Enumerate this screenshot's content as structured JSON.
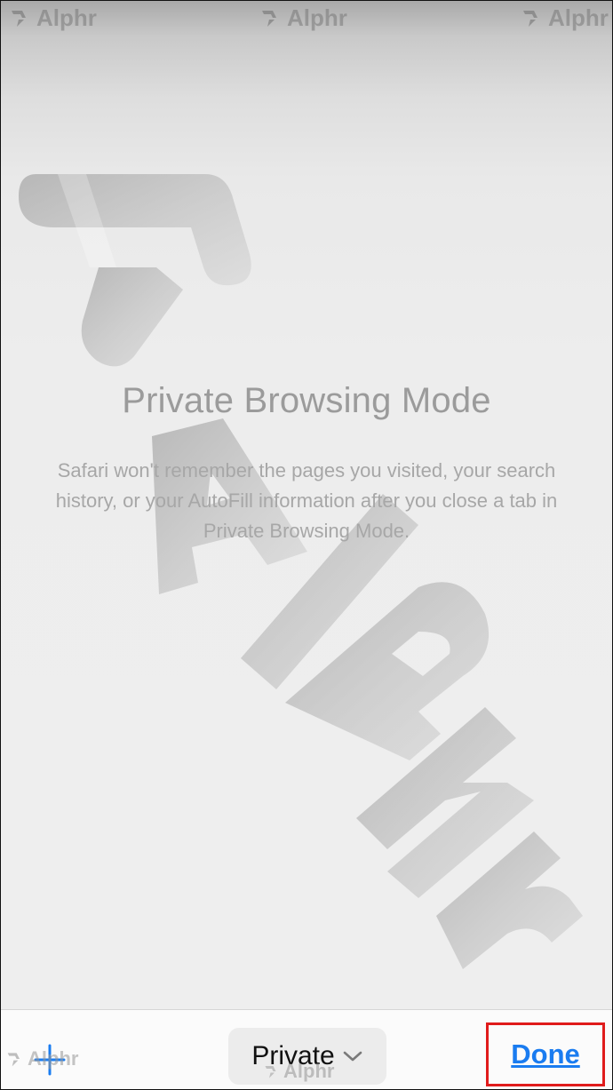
{
  "watermark": {
    "brand": "Alphr"
  },
  "private_mode": {
    "title": "Private Browsing Mode",
    "description": "Safari won't remember the pages you visited, your search history, or your AutoFill information after you close a tab in Private Browsing Mode."
  },
  "toolbar": {
    "new_tab_icon": "plus-icon",
    "tab_group_label": "Private",
    "tab_group_icon": "chevron-down-icon",
    "done_label": "Done"
  },
  "colors": {
    "accent": "#1a7cf0",
    "highlight_box": "#e01b1b",
    "title_text": "#9b9b9b"
  }
}
